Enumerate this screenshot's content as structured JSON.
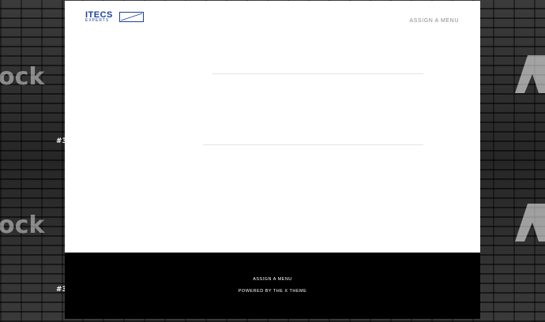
{
  "background": {
    "watermark_text_1": "ock",
    "watermark_text_2": "ock",
    "watermark_num_1": "#3",
    "watermark_num_2": "#3"
  },
  "header": {
    "logo_top": "ITECS",
    "logo_bottom": "EXPERTS",
    "nav_menu": "ASSIGN A MENU"
  },
  "footer": {
    "menu": "ASSIGN A MENU",
    "powered_by": "POWERED BY THE X THEME"
  },
  "colors": {
    "brand_blue": "#1a3fa0",
    "footer_bg": "#000000",
    "page_bg": "#ffffff"
  }
}
